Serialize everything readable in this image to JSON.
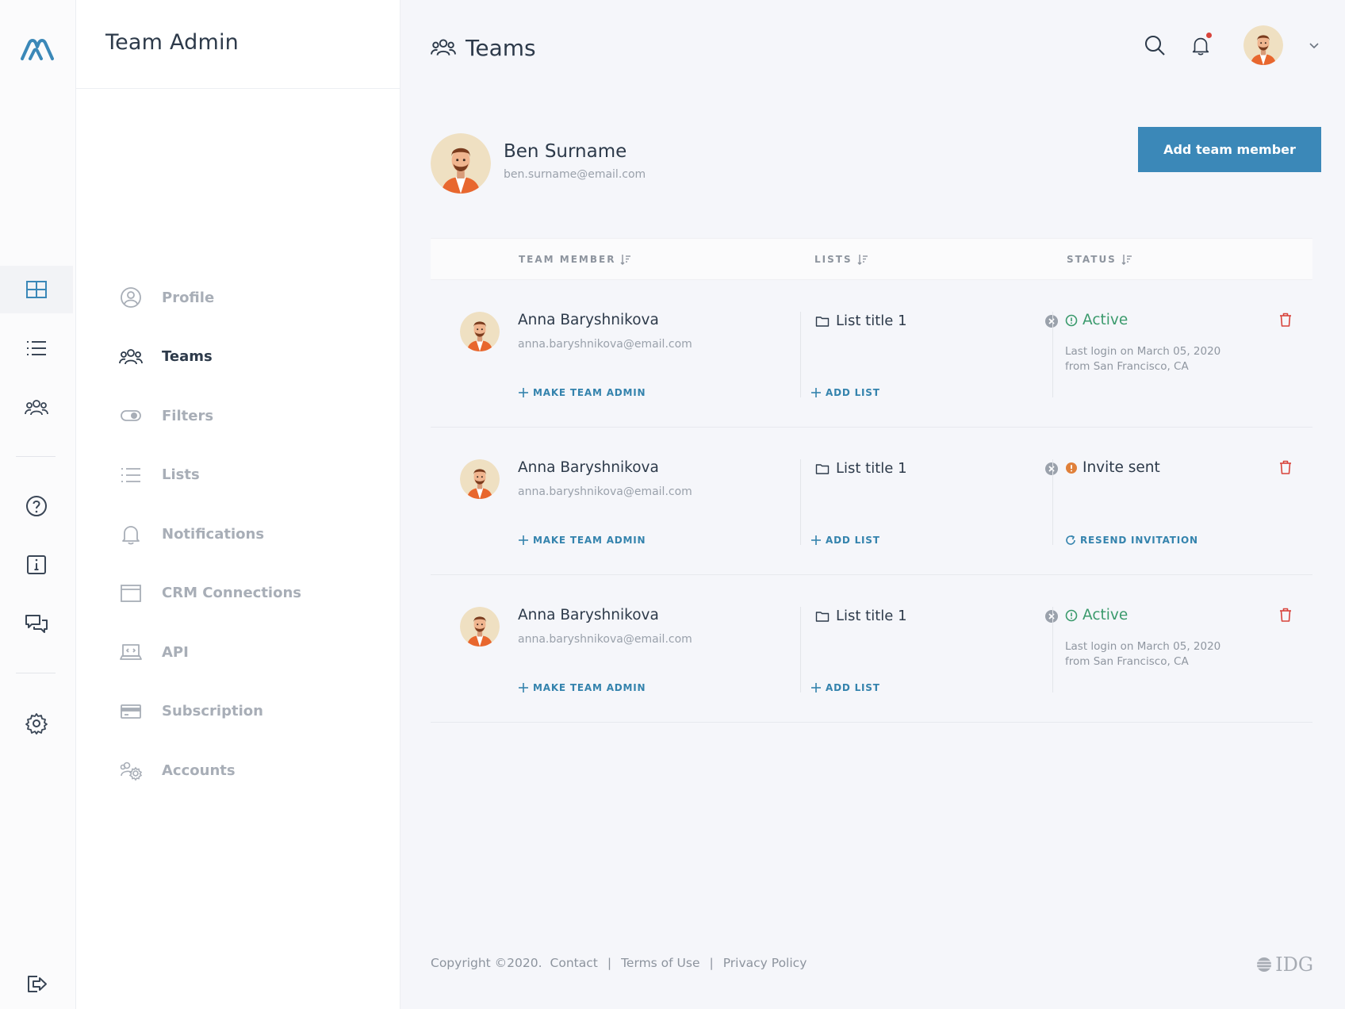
{
  "app": {
    "section_title": "Team Admin",
    "page_title": "Teams"
  },
  "rail": {
    "items": [
      {
        "icon": "dashboard-grid-icon",
        "active": true
      },
      {
        "icon": "list-icon",
        "active": false
      },
      {
        "icon": "team-icon",
        "active": false
      },
      {
        "icon": "help-icon",
        "active": false
      },
      {
        "icon": "info-icon",
        "active": false
      },
      {
        "icon": "chat-icon",
        "active": false
      },
      {
        "icon": "gear-icon",
        "active": false
      },
      {
        "icon": "logout-icon",
        "active": false
      }
    ]
  },
  "sidebar": {
    "items": [
      {
        "label": "Profile",
        "icon": "user-circle-icon",
        "active": false
      },
      {
        "label": "Teams",
        "icon": "team-icon",
        "active": true
      },
      {
        "label": "Filters",
        "icon": "toggle-icon",
        "active": false
      },
      {
        "label": "Lists",
        "icon": "list-icon",
        "active": false
      },
      {
        "label": "Notifications",
        "icon": "bell-icon",
        "active": false
      },
      {
        "label": "CRM Connections",
        "icon": "browser-window-icon",
        "active": false
      },
      {
        "label": "API",
        "icon": "laptop-code-icon",
        "active": false
      },
      {
        "label": "Subscription",
        "icon": "credit-card-icon",
        "active": false
      },
      {
        "label": "Accounts",
        "icon": "accounts-gear-icon",
        "active": false
      }
    ]
  },
  "owner": {
    "name": "Ben Surname",
    "email": "ben.surname@email.com"
  },
  "add_button": "Add team member",
  "table": {
    "headers": [
      "TEAM MEMBER",
      "LISTS",
      "STATUS"
    ],
    "rows": [
      {
        "name": "Anna Baryshnikova",
        "email": "anna.baryshnikova@email.com",
        "make_admin": "MAKE TEAM ADMIN",
        "list": "List title 1",
        "add_list": "ADD LIST",
        "status": "Active",
        "status_type": "active",
        "last_login": "Last login on March 05, 2020",
        "from": "from San Francisco, CA"
      },
      {
        "name": "Anna Baryshnikova",
        "email": "anna.baryshnikova@email.com",
        "make_admin": "MAKE TEAM ADMIN",
        "list": "List title 1",
        "add_list": "ADD LIST",
        "status": "Invite sent",
        "status_type": "invite",
        "resend": "RESEND INVITATION"
      },
      {
        "name": "Anna Baryshnikova",
        "email": "anna.baryshnikova@email.com",
        "make_admin": "MAKE TEAM ADMIN",
        "list": "List title 1",
        "add_list": "ADD LIST",
        "status": "Active",
        "status_type": "active",
        "last_login": "Last login on March 05, 2020",
        "from": "from San Francisco, CA"
      }
    ]
  },
  "footer": {
    "copyright": "Copyright ©2020.",
    "contact": "Contact",
    "terms": "Terms of Use",
    "privacy": "Privacy Policy",
    "separator": "|",
    "brand": "IDG"
  },
  "colors": {
    "accent": "#3b88b8",
    "link": "#3483ad",
    "active_status": "#3a9a6c",
    "invite_status": "#e0803a",
    "delete": "#d8433b",
    "notification_dot": "#d8433b"
  }
}
